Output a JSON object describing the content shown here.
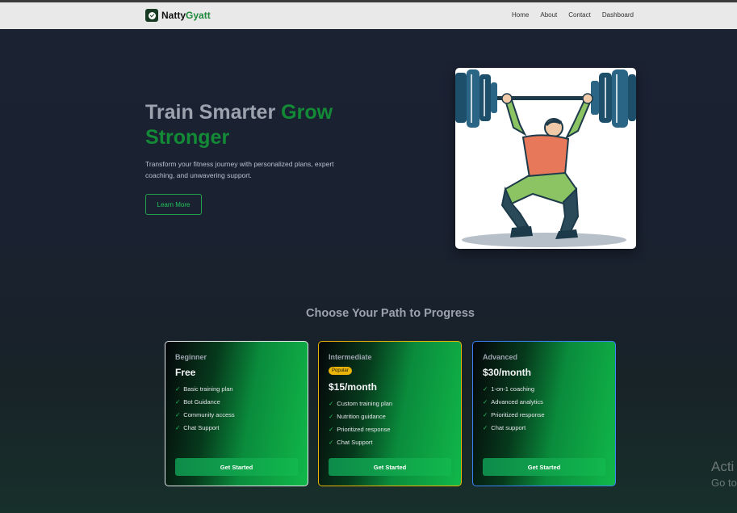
{
  "brand": {
    "name": "Natty",
    "accent": "Gyatt"
  },
  "nav": {
    "home": "Home",
    "about": "About",
    "contact": "Contact",
    "dashboard": "Dashboard"
  },
  "hero": {
    "title_part1": "Train Smarter ",
    "title_part2": "Grow Stronger",
    "subtitle": "Transform your fitness journey with personalized plans, expert coaching, and unwavering support.",
    "cta": "Learn More"
  },
  "plans_section": {
    "title": "Choose Your Path to Progress",
    "plans": [
      {
        "tier": "Beginner",
        "price": "Free",
        "badge": "",
        "features": [
          "Basic training plan",
          "Bot Guidance",
          "Community access",
          "Chat Support"
        ],
        "cta": "Get Started"
      },
      {
        "tier": "Intermediate",
        "price": "$15/month",
        "badge": "Popular",
        "features": [
          "Custom training plan",
          "Nutrition guidance",
          "Prioritized response",
          "Chat Support"
        ],
        "cta": "Get Started"
      },
      {
        "tier": "Advanced",
        "price": "$30/month",
        "badge": "",
        "features": [
          "1-on-1 coaching",
          "Advanced analytics",
          "Prioritized response",
          "Chat support"
        ],
        "cta": "Get Started"
      }
    ]
  },
  "watermark": {
    "line1": "Acti",
    "line2": "Go to"
  },
  "colors": {
    "accent": "#138a36",
    "popular": "#eab308",
    "advanced_border": "#3b82f6"
  }
}
